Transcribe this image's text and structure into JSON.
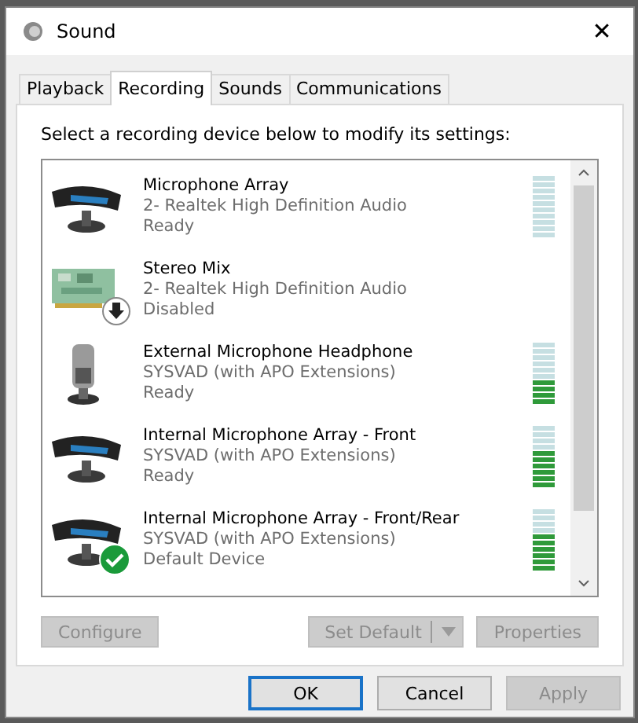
{
  "window": {
    "title": "Sound",
    "close": "✕"
  },
  "tabs": [
    {
      "label": "Playback",
      "selected": false
    },
    {
      "label": "Recording",
      "selected": true
    },
    {
      "label": "Sounds",
      "selected": false
    },
    {
      "label": "Communications",
      "selected": false
    }
  ],
  "instruction": "Select a recording device below to modify its settings:",
  "devices": [
    {
      "kind": "mic-array",
      "default": false,
      "disabled": false,
      "name": "Microphone Array",
      "driver": "2- Realtek High Definition Audio",
      "status": "Ready",
      "level": 0
    },
    {
      "kind": "sound-card",
      "default": false,
      "disabled": true,
      "name": "Stereo Mix",
      "driver": "2- Realtek High Definition Audio",
      "status": "Disabled"
    },
    {
      "kind": "headset-mic",
      "default": false,
      "disabled": false,
      "name": "External Microphone Headphone",
      "driver": "SYSVAD (with APO Extensions)",
      "status": "Ready",
      "level": 0.4
    },
    {
      "kind": "mic-array",
      "default": false,
      "disabled": false,
      "name": "Internal Microphone Array - Front",
      "driver": "SYSVAD (with APO Extensions)",
      "status": "Ready",
      "level": 0.6
    },
    {
      "kind": "mic-array",
      "default": true,
      "disabled": false,
      "name": "Internal Microphone Array - Front/Rear",
      "driver": "SYSVAD (with APO Extensions)",
      "status": "Default Device",
      "level": 0.6
    }
  ],
  "device_buttons": [
    {
      "label": "Configure",
      "kind": "plain",
      "disabled": true
    },
    {
      "label": "Set Default",
      "kind": "split",
      "disabled": true
    },
    {
      "label": "Properties",
      "kind": "plain",
      "disabled": true
    }
  ],
  "dialog_buttons": [
    {
      "label": "OK",
      "default": true,
      "disabled": false
    },
    {
      "label": "Cancel",
      "default": false,
      "disabled": false
    },
    {
      "label": "Apply",
      "default": false,
      "disabled": true
    }
  ]
}
